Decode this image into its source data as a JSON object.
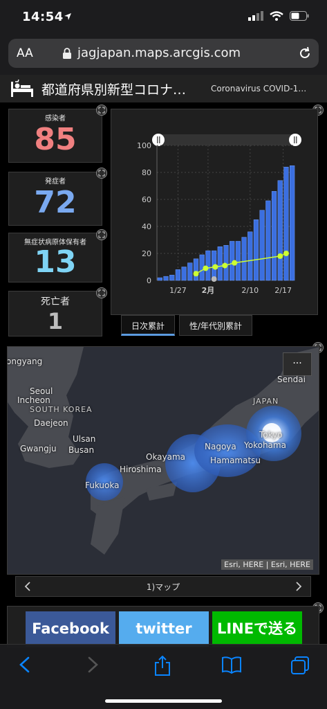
{
  "status": {
    "time": "14:54"
  },
  "browser": {
    "aa": "AA",
    "url": "jagjapan.maps.arcgis.com"
  },
  "dashboard": {
    "title": "都道府県別新型コロナ…",
    "subtitle": "Coronavirus COVID-1…"
  },
  "indicators": [
    {
      "label": "感染者",
      "value": "85",
      "color": "#f08080"
    },
    {
      "label": "発症者",
      "value": "72",
      "color": "#7aa9f0"
    },
    {
      "label": "無症状病原体保有者",
      "value": "13",
      "color": "#7fd4f5"
    },
    {
      "label": "死亡者",
      "value": "1",
      "color": "#bdbdbd"
    }
  ],
  "chart_data": {
    "type": "bar",
    "ylim": [
      0,
      100
    ],
    "yticks": [
      "0",
      "20",
      "40",
      "60",
      "80",
      "100"
    ],
    "xticks": [
      "1/27",
      "2月",
      "2/10",
      "2/17"
    ],
    "bars": [
      2,
      3,
      4,
      8,
      10,
      13,
      16,
      19,
      22,
      22,
      25,
      26,
      29,
      29,
      32,
      36,
      45,
      52,
      59,
      66,
      74,
      84,
      85
    ],
    "line": {
      "x_start_index": 14,
      "values": [
        5,
        9,
        10,
        11,
        13
      ]
    },
    "line_extra": {
      "values": [
        18,
        20
      ]
    },
    "marker_gray": 1,
    "bar_color": "#3b6fe0",
    "line_color": "#ccff33"
  },
  "tabs": [
    {
      "label": "日次累計",
      "active": true
    },
    {
      "label": "性/年代別累計",
      "active": false
    }
  ],
  "map": {
    "labels": [
      {
        "text": "ongyang",
        "cls": ""
      },
      {
        "text": "Seoul",
        "cls": ""
      },
      {
        "text": "Incheon",
        "cls": ""
      },
      {
        "text": "SOUTH KOREA",
        "cls": "country"
      },
      {
        "text": "Daejeon",
        "cls": ""
      },
      {
        "text": "Ulsan",
        "cls": ""
      },
      {
        "text": "Gwangju",
        "cls": ""
      },
      {
        "text": "Busan",
        "cls": ""
      },
      {
        "text": "Okayama",
        "cls": ""
      },
      {
        "text": "Hiroshima",
        "cls": ""
      },
      {
        "text": "Fukuoka",
        "cls": ""
      },
      {
        "text": "Nagoya",
        "cls": ""
      },
      {
        "text": "Hamamatsu",
        "cls": ""
      },
      {
        "text": "Yokohama",
        "cls": ""
      },
      {
        "text": "Tokyo",
        "cls": ""
      },
      {
        "text": "JAPAN",
        "cls": "country"
      },
      {
        "text": "Sendai",
        "cls": ""
      }
    ],
    "attribution": "Esri, HERE | Esri, HERE",
    "more": "···"
  },
  "pager": {
    "label": "1)マップ"
  },
  "share": [
    {
      "label": "Facebook",
      "color": "#3b5998"
    },
    {
      "label": "twitter",
      "color": "#55acee"
    },
    {
      "label": "LINEで送る",
      "color": "#00b900"
    }
  ]
}
